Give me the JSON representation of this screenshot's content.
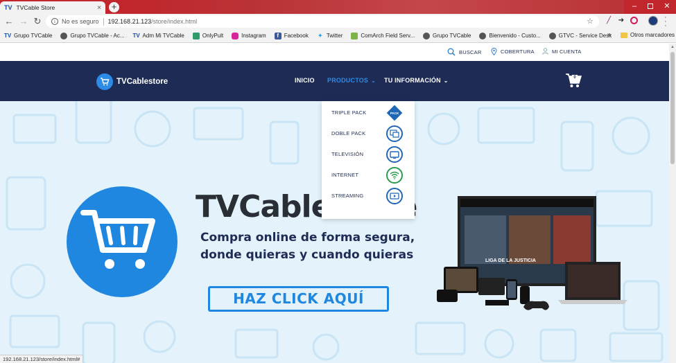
{
  "browser": {
    "tab_title": "TVCable Store",
    "tab_favicon": "TV",
    "close_glyph": "×",
    "new_tab_glyph": "+",
    "back_glyph": "←",
    "forward_glyph": "→",
    "reload_glyph": "↻",
    "security_label": "No es seguro",
    "url_host": "192.168.21.123",
    "url_path": "/store/index.html",
    "star_glyph": "☆",
    "min_glyph": "–",
    "close_win_glyph": "✕",
    "bookmarks": [
      {
        "label": "Grupo TVCable",
        "icon": "tvcable-icon"
      },
      {
        "label": "Grupo TVCable - Ac...",
        "icon": "globe-icon"
      },
      {
        "label": "Adm Mi TVCable",
        "icon": "tvcable-icon"
      },
      {
        "label": "OnlyPult",
        "icon": "onlypult-icon"
      },
      {
        "label": "Instagram",
        "icon": "instagram-icon"
      },
      {
        "label": "Facebook",
        "icon": "facebook-icon"
      },
      {
        "label": "Twitter",
        "icon": "twitter-icon"
      },
      {
        "label": "ComArch Field Serv...",
        "icon": "comarch-icon"
      },
      {
        "label": "Grupo TVCable",
        "icon": "globe-icon"
      },
      {
        "label": "Bienvenido - Custo...",
        "icon": "globe-icon"
      },
      {
        "label": "GTVC - Service Desk",
        "icon": "globe-icon"
      }
    ],
    "bookmarks_more": "»",
    "other_bookmarks": "Otros marcadores",
    "status_url": "192.168.21.123/store/index.html#"
  },
  "site": {
    "utility": {
      "search": "BUSCAR",
      "coverage": "COBERTURA",
      "account": "MI CUENTA"
    },
    "logo_text": "TVCablestore",
    "nav": {
      "home": "INICIO",
      "products": "PRODUCTOS",
      "your_info": "TU INFORMACIÓN",
      "chevron": "⌄"
    },
    "cart_count": "0",
    "products_menu": [
      {
        "label": "TRIPLE PACK",
        "icon": "triple-pack-icon"
      },
      {
        "label": "DOBLE PACK",
        "icon": "double-pack-icon"
      },
      {
        "label": "TELEVISIÓN",
        "icon": "tv-icon"
      },
      {
        "label": "INTERNET",
        "icon": "wifi-icon"
      },
      {
        "label": "STREAMING",
        "icon": "streaming-icon"
      }
    ],
    "hero": {
      "headline": "TVCablestore",
      "subline_1": "Compra online de forma segura,",
      "subline_2": "donde quieras y cuando quieras",
      "cta": "HAZ CLICK AQUÍ",
      "screen_caption": "LIGA DE LA JUSTICIA"
    }
  },
  "colors": {
    "navy": "#1d2b55",
    "accent_blue": "#1f87e0",
    "hero_bg": "#e3f2fb",
    "chrome_red": "#c0262b"
  }
}
